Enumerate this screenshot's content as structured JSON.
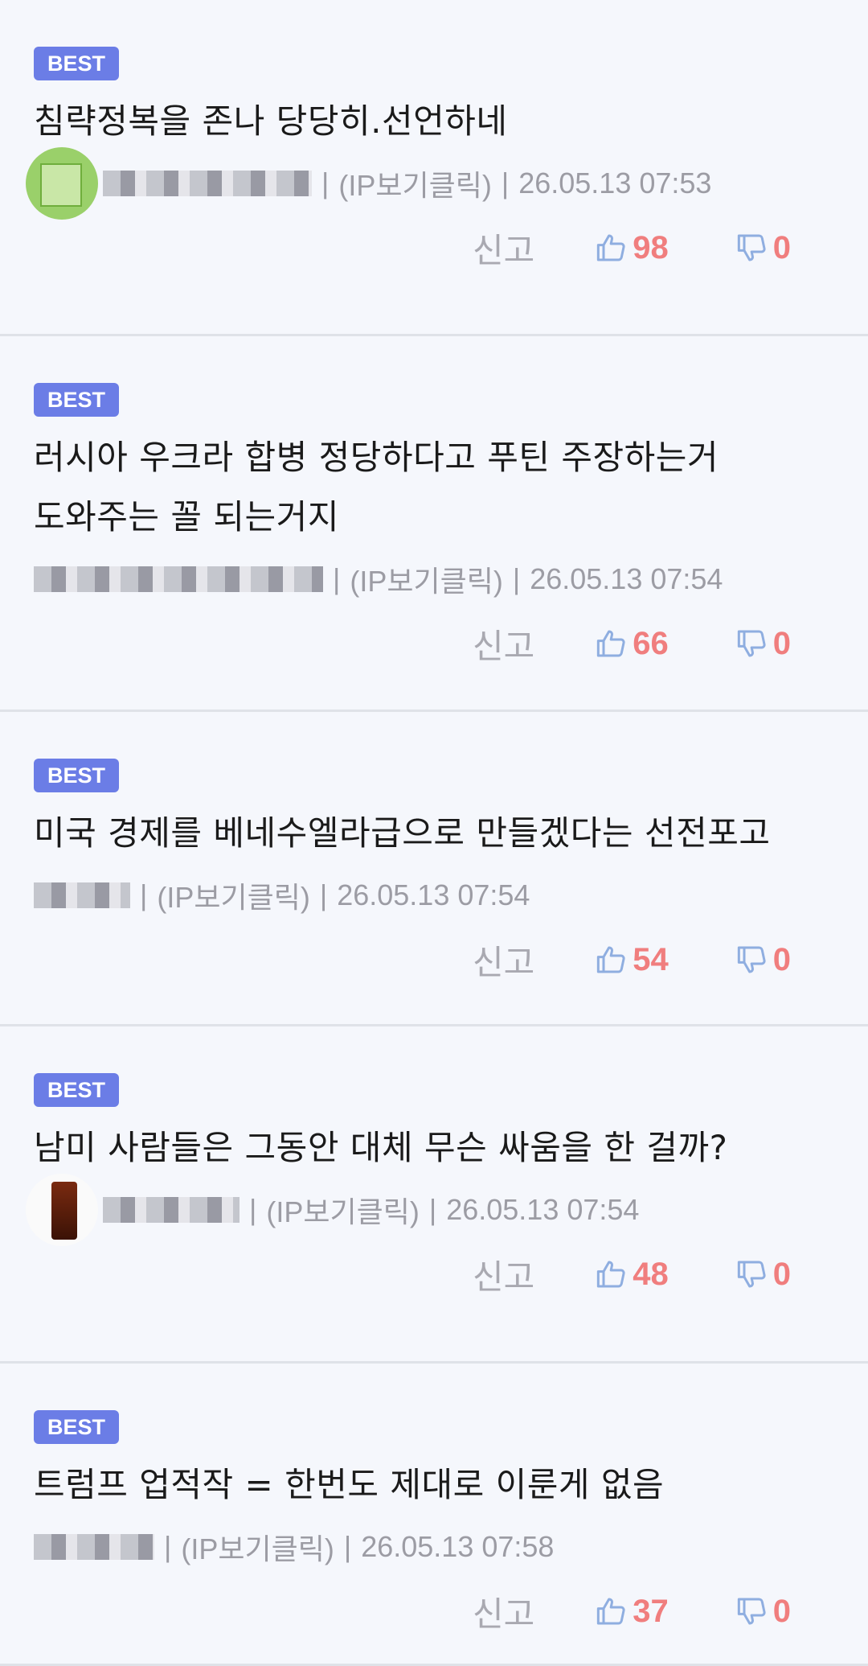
{
  "comments": [
    {
      "badge": "BEST",
      "text": "침략정복을 존나 당당히.선언하네",
      "avatar": "green",
      "nick_w": 260,
      "ip_label": "(IP보기클릭)",
      "date": "26.05.13 07:53",
      "report": "신고",
      "up": "98",
      "down": "0"
    },
    {
      "badge": "BEST",
      "text": "러시아 우크라 합병 정당하다고 푸틴 주장하는거\n도와주는 꼴 되는거지",
      "avatar": "none",
      "nick_w": 360,
      "ip_label": "(IP보기클릭)",
      "date": "26.05.13 07:54",
      "report": "신고",
      "up": "66",
      "down": "0"
    },
    {
      "badge": "BEST",
      "text": "미국 경제를 베네수엘라급으로 만들겠다는 선전포고",
      "avatar": "none",
      "nick_w": 120,
      "ip_label": "(IP보기클릭)",
      "date": "26.05.13 07:54",
      "report": "신고",
      "up": "54",
      "down": "0"
    },
    {
      "badge": "BEST",
      "text": "남미 사람들은 그동안 대체 무슨 싸움을 한 걸까?",
      "avatar": "drink",
      "nick_w": 170,
      "ip_label": "(IP보기클릭)",
      "date": "26.05.13 07:54",
      "report": "신고",
      "up": "48",
      "down": "0"
    },
    {
      "badge": "BEST",
      "text": "트럼프 업적작 = 한번도 제대로 이룬게 없음",
      "avatar": "none",
      "nick_w": 150,
      "ip_label": "(IP보기클릭)",
      "date": "26.05.13 07:58",
      "report": "신고",
      "up": "37",
      "down": "0"
    }
  ],
  "colors": {
    "badge": "#6b7de6",
    "vote_count": "#f07e7e",
    "thumb_icon": "#8faee0",
    "meta_text": "#9c9ca4"
  },
  "icons": {
    "up": "thumbs-up-icon",
    "down": "thumbs-down-icon"
  }
}
